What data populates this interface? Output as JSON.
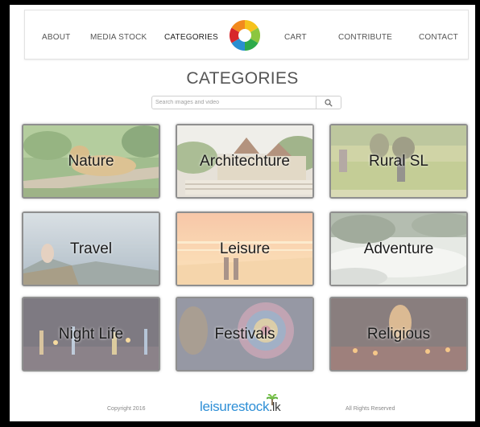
{
  "nav": {
    "items": [
      {
        "label": "ABOUT"
      },
      {
        "label": "MEDIA STOCK"
      },
      {
        "label": "CATEGORIES"
      },
      {
        "label": "CART"
      },
      {
        "label": "CONTRIBUTE"
      },
      {
        "label": "CONTACT"
      }
    ],
    "active": "CATEGORIES"
  },
  "page": {
    "title": "CATEGORIES"
  },
  "search": {
    "placeholder": "Search images and video",
    "value": ""
  },
  "categories": [
    {
      "label": "Nature"
    },
    {
      "label": "Architechture"
    },
    {
      "label": "Rural SL"
    },
    {
      "label": "Travel"
    },
    {
      "label": "Leisure"
    },
    {
      "label": "Adventure"
    },
    {
      "label": "Night Life"
    },
    {
      "label": "Festivals"
    },
    {
      "label": "Religious"
    }
  ],
  "footer": {
    "copyright": "Copyright 2016",
    "logo_main": "leisurestock",
    "logo_tld": ".lk",
    "rights": "All Rights Reserved"
  },
  "colors": {
    "background": "#000000",
    "page": "#ffffff",
    "card_border": "#8f8f8f",
    "logo_blue": "#2e8fd6"
  }
}
